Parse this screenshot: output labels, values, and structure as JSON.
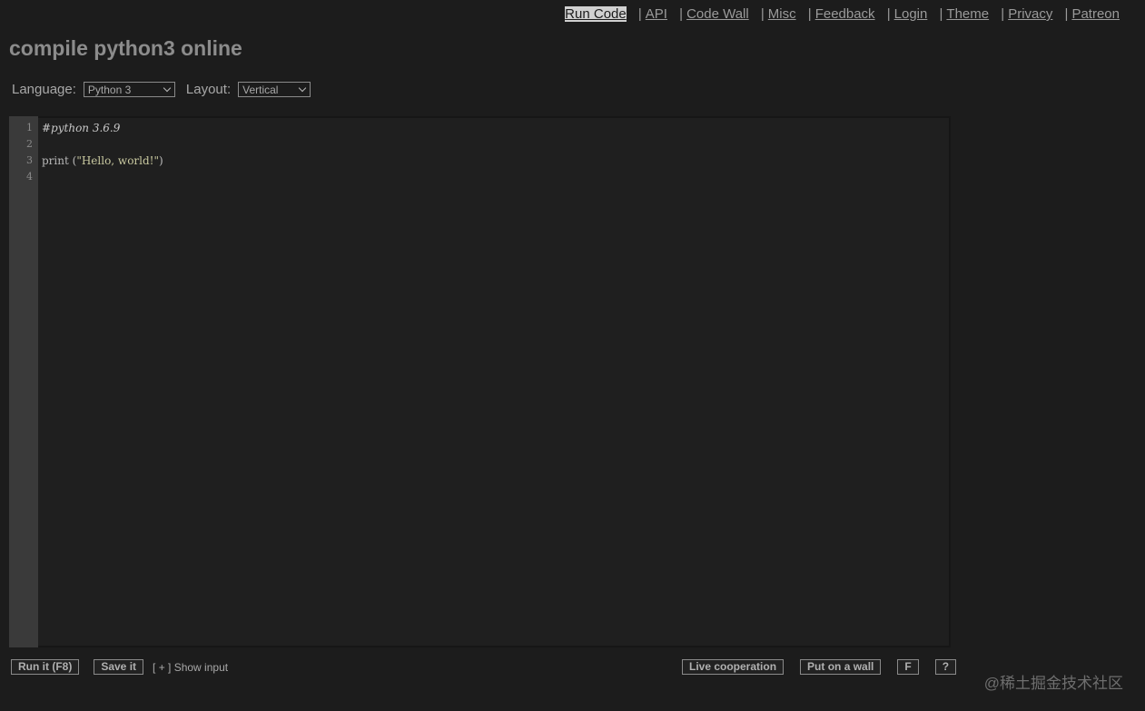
{
  "nav": {
    "items": [
      {
        "label": "Run Code",
        "active": true
      },
      {
        "label": "API"
      },
      {
        "label": "Code Wall"
      },
      {
        "label": "Misc"
      },
      {
        "label": "Feedback"
      },
      {
        "label": "Login"
      },
      {
        "label": "Theme"
      },
      {
        "label": "Privacy"
      },
      {
        "label": "Patreon"
      }
    ],
    "separator": "|"
  },
  "page_title": "compile python3 online",
  "controls": {
    "language_label": "Language:",
    "language_value": "Python 3",
    "layout_label": "Layout:",
    "layout_value": "Vertical"
  },
  "editor": {
    "line_numbers": [
      "1",
      "2",
      "3",
      "4"
    ],
    "lines": {
      "l1_comment": "#python 3.6.9",
      "l2": "",
      "l3_fn": "print (",
      "l3_str": "\"Hello, world!\"",
      "l3_close": ")",
      "l4": ""
    }
  },
  "bottom": {
    "run_label": "Run it (F8)",
    "save_label": "Save it",
    "show_input_label": "[ + ] Show input",
    "live_label": "Live cooperation",
    "wall_label": "Put on a wall",
    "f_label": "F",
    "help_label": "?"
  },
  "watermark": "@稀土掘金技术社区",
  "colors": {
    "background": "#1c1c1c",
    "editor_bg": "#1f1f1f",
    "gutter_bg": "#3a3a3a",
    "text": "#a8a8a8"
  }
}
